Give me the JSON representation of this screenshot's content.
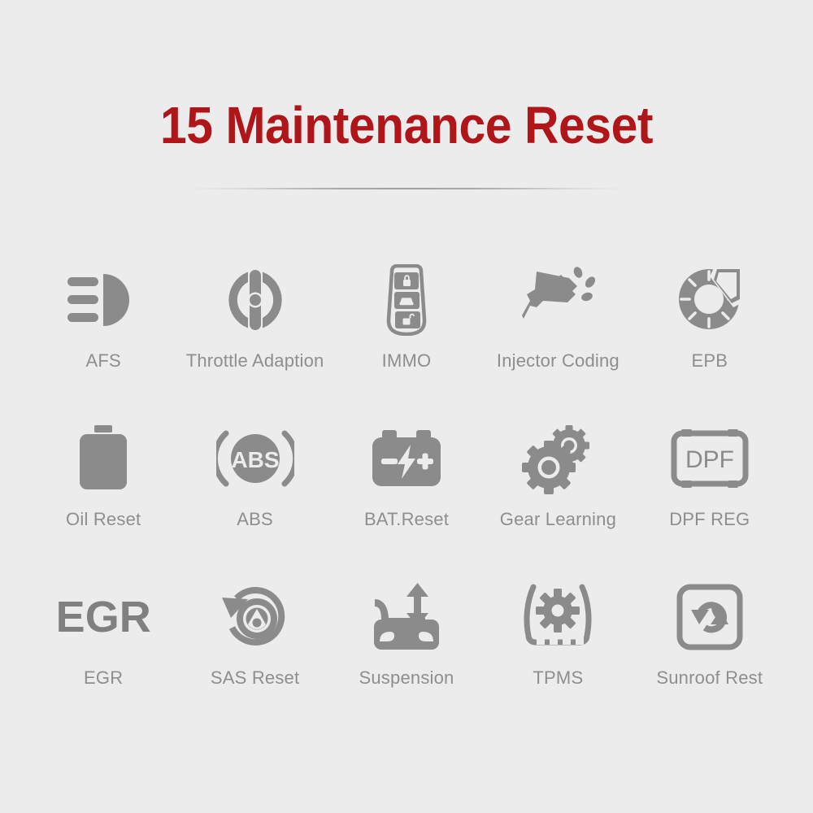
{
  "header": {
    "title": "15 Maintenance Reset",
    "title_color": "#b0151a"
  },
  "theme": {
    "background": "#ececec",
    "icon_color": "#8b8b8b",
    "label_color": "#8e8e8e",
    "divider_color": "#929292"
  },
  "grid": {
    "columns": 5,
    "rows": 3,
    "items": [
      {
        "label": "AFS",
        "icon": "headlight-afs-icon"
      },
      {
        "label": "Throttle Adaption",
        "icon": "throttle-body-icon"
      },
      {
        "label": "IMMO",
        "icon": "car-key-fob-icon"
      },
      {
        "label": "Injector Coding",
        "icon": "fuel-injector-icon"
      },
      {
        "label": "EPB",
        "icon": "brake-disc-caliper-icon"
      },
      {
        "label": "Oil Reset",
        "icon": "oil-can-icon"
      },
      {
        "label": "ABS",
        "icon": "abs-brake-icon"
      },
      {
        "label": "BAT.Reset",
        "icon": "car-battery-icon"
      },
      {
        "label": "Gear Learning",
        "icon": "two-gears-icon"
      },
      {
        "label": "DPF REG",
        "icon": "dpf-filter-icon",
        "glyph_text": "DPF"
      },
      {
        "label": "EGR",
        "icon": "egr-text-icon",
        "glyph_text": "EGR"
      },
      {
        "label": "SAS Reset",
        "icon": "steering-angle-reset-icon"
      },
      {
        "label": "Suspension",
        "icon": "car-suspension-arrow-icon"
      },
      {
        "label": "TPMS",
        "icon": "tire-pressure-icon"
      },
      {
        "label": "Sunroof Rest",
        "icon": "sunroof-reset-icon"
      }
    ]
  }
}
